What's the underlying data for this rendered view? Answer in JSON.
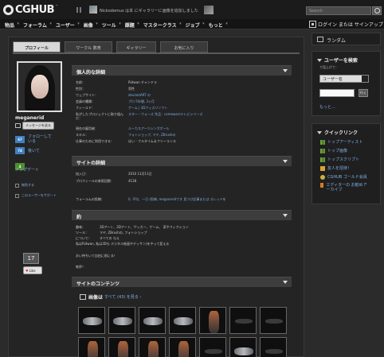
{
  "header": {
    "logo_text": "CGHUB",
    "logo_tm": "™",
    "news_text": "Nickodemus は本 にギャラリーに画像を追加しました",
    "search_placeholder": "Search"
  },
  "nav": {
    "items": [
      "物品",
      "フォーラム",
      "ユーザー",
      "画像",
      "ツール",
      "課題",
      "マスタークラス",
      "ジョブ",
      "もっと"
    ],
    "login_text": "ログイン または サインアップ！"
  },
  "tabs": [
    "プロフィール",
    "ワークル 数育",
    "ギャラリー",
    "お気に入り"
  ],
  "profile": {
    "username": "meganerid",
    "message_button": "メッセージを送る",
    "following_count": "67",
    "following_label": "フォローしている",
    "followers_count": "74",
    "followers_label": "後いて",
    "updates_count": "4",
    "updates_label": "アップデート",
    "block_label": "無防する",
    "report_label": "このユーザーをサポート",
    "like_count": "17",
    "like_label": "Like"
  },
  "personal": {
    "title": "個人的な詳細",
    "rows": [
      {
        "k": "名前：",
        "v": "Ridwan チャンドラ",
        "link": false
      },
      {
        "k": "性別：",
        "v": "男性",
        "link": false
      },
      {
        "k": "ウェブサイト：",
        "v": "deviantART の",
        "link": true
      },
      {
        "k": "会員の種類：",
        "v": "プロ 5年間, 3ヶ月",
        "link": true
      },
      {
        "k": "フィールド：",
        "v": "ゲーム | 3Dフィズリソフト",
        "link": true
      },
      {
        "k": "私がしたプロジェクトに取り組んだ：",
        "v": "スター・ウォーズ 作品：comewarsテレビシリーズ",
        "link": true
      },
      {
        "k": "現在の雇用者：",
        "v": "ルーカスアーツシンガポール",
        "link": true
      },
      {
        "k": "スキル：",
        "v": "フォトショップ, マヤ, ZBrushの",
        "link": true
      },
      {
        "k": "仕事のために利用できる：",
        "v": "はい - フルタイム＆フリーランス",
        "link": false
      }
    ]
  },
  "site": {
    "title": "サイトの詳細",
    "rows": [
      {
        "k": "加入日：",
        "v": "2010 11月11日"
      },
      {
        "k": "プロフィールの参照回数：",
        "v": "4128"
      }
    ],
    "forum_k": "フォーラムの投稿：",
    "forum_v": "0, 平均、一日 (投稿, meganeridです 見つけ記事または スレッドを"
  },
  "about": {
    "title": "約",
    "hobby_k": "趣味：",
    "hobby_v": "3Dアート、2Dアート、サッカー、ゲーム、 家やフィクション",
    "tools_k": "ツール：",
    "tools_v": "マヤ, ZBrushの, フォトショップ",
    "about_k": "について：",
    "about_v": "すべての 与え",
    "bio": "私はRidwan, 私は3Dも デジタル絵画やデッサン)をやって変える",
    "thanks": "おい待ちいて自由に前にる！",
    "cheers": "乾杯！"
  },
  "content": {
    "title": "サイトのコンテンツ",
    "gallery_label": "画像は",
    "gallery_more": "すべて (43) を見る ›"
  },
  "sidebar": {
    "random_label": "ランダム",
    "search_title": "ユーザーを検索",
    "search_sub": "で見上げて：",
    "search_select": "ユーザー名",
    "search_go": "行く",
    "search_more": "もっと...",
    "quick_title": "クイックリンク",
    "quick_links": [
      "トップアーティスト",
      "トップ画像",
      "トップスクリプト",
      "友人を招待！",
      "CGHUB ゴールド会員",
      "エディターの お勧めアーカイブ"
    ]
  }
}
